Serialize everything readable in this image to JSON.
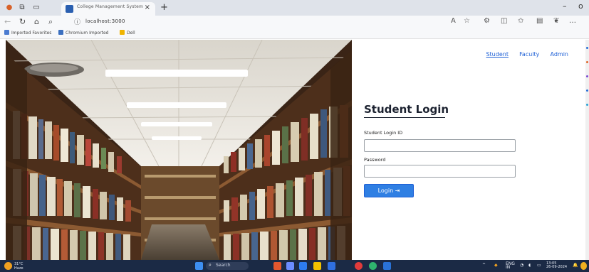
{
  "browser": {
    "tab_title": "College Management System",
    "tab_close": "×",
    "new_tab": "+",
    "window_minimize": "–",
    "window_restore": "o",
    "url": "localhost:3000",
    "bookmarks": [
      "Imported Favorites",
      "Chromium Imported",
      "Dell"
    ],
    "bookmark_colors": [
      "#4b7bd0",
      "#3b6fbf",
      "#f0b400"
    ]
  },
  "nav": {
    "student": "Student",
    "faculty": "Faculty",
    "admin": "Admin"
  },
  "login": {
    "title": "Student Login",
    "id_label": "Student Login ID",
    "id_value": "",
    "password_label": "Password",
    "password_value": "",
    "button": "Login  ⇥"
  },
  "taskbar": {
    "search": "Search",
    "weather_temp": "31°C",
    "weather_desc": "Haze",
    "lang": "ENG",
    "lang_sub": "IN",
    "time": "13:05",
    "date": "26-09-2024"
  },
  "colors": {
    "accent": "#1e60d6",
    "button": "#2f7fe3",
    "taskbar": "#1b2a45"
  }
}
